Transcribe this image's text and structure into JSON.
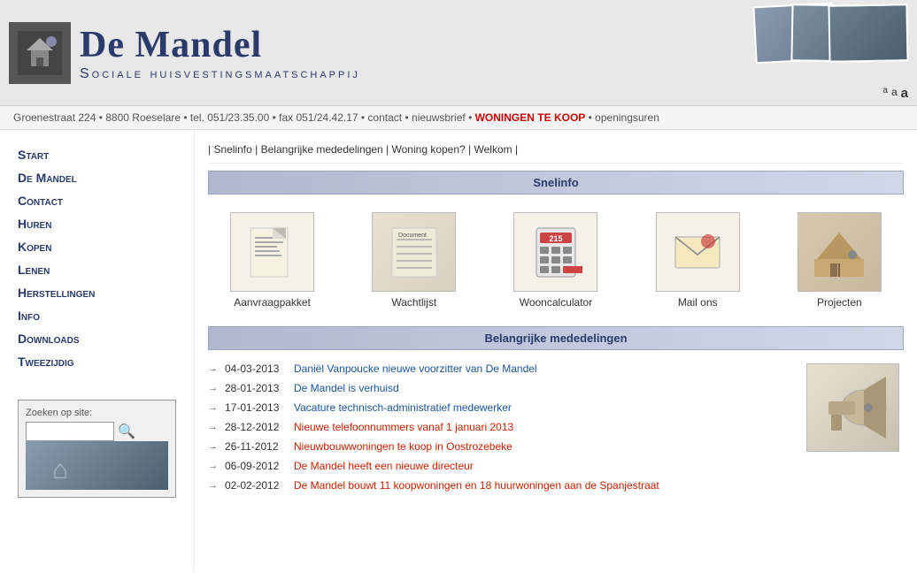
{
  "header": {
    "title": "De Mandel",
    "subtitle": "Sociale huisvestingsmaatschappij",
    "font_controls": [
      "a",
      "a",
      "a"
    ]
  },
  "address_bar": {
    "address": "Groenestraat 224 • 8800 Roeselare • tel. 051/23.35.00 • fax 051/24.42.17 •",
    "contact": "contact",
    "newsbrief": "nieuwsbrief",
    "woningen": "WONINGEN TE KOOP",
    "openingsuren": "openingsuren"
  },
  "sidebar": {
    "nav_items": [
      {
        "label": "Start",
        "id": "start"
      },
      {
        "label": "De Mandel",
        "id": "de-mandel"
      },
      {
        "label": "Contact",
        "id": "contact"
      },
      {
        "label": "Huren",
        "id": "huren"
      },
      {
        "label": "Kopen",
        "id": "kopen"
      },
      {
        "label": "Lenen",
        "id": "lenen"
      },
      {
        "label": "Herstellingen",
        "id": "herstellingen"
      },
      {
        "label": "Info",
        "id": "info"
      },
      {
        "label": "Downloads",
        "id": "downloads"
      },
      {
        "label": "Tweezijdig",
        "id": "tweezijdig"
      }
    ],
    "search_label": "Zoeken op site:",
    "search_placeholder": ""
  },
  "content": {
    "quick_nav": [
      "Snelinfo",
      "Belangrijke mededelingen",
      "Woning kopen?",
      "Welkom"
    ],
    "snelinfo_header": "Snelinfo",
    "snelinfo_items": [
      {
        "label": "Aanvraagpakket",
        "id": "aanvraagpakket"
      },
      {
        "label": "Wachtlijst",
        "id": "wachtlijst"
      },
      {
        "label": "Wooncalculator",
        "id": "wooncalculator"
      },
      {
        "label": "Mail ons",
        "id": "mail-ons"
      },
      {
        "label": "Projecten",
        "id": "projecten"
      }
    ],
    "mededelingen_header": "Belangrijke mededelingen",
    "mededelingen": [
      {
        "date": "04-03-2013",
        "text": "Daniël Vanpoucke nieuwe voorzitter van De Mandel",
        "highlight": false
      },
      {
        "date": "28-01-2013",
        "text": "De Mandel is verhuisd",
        "highlight": false
      },
      {
        "date": "17-01-2013",
        "text": "Vacature technisch-administratief medewerker",
        "highlight": false
      },
      {
        "date": "28-12-2012",
        "text": "Nieuwe telefoonnummers vanaf 1 januari 2013",
        "highlight": true
      },
      {
        "date": "26-11-2012",
        "text": "Nieuwbouwwoningen te koop in Oostrozebeke",
        "highlight": true
      },
      {
        "date": "06-09-2012",
        "text": "De Mandel heeft een nieuwe directeur",
        "highlight": true
      },
      {
        "date": "02-02-2012",
        "text": "De Mandel bouwt 11 koopwoningen en 18 huurwoningen aan de Spanjestraat",
        "highlight": true
      }
    ]
  }
}
